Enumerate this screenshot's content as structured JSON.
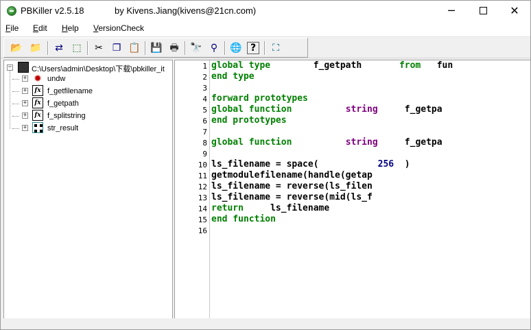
{
  "window": {
    "title": "PBKiller v2.5.18",
    "author": "by Kivens.Jiang(kivens@21cn.com)",
    "minimize": "─",
    "close": "✕"
  },
  "menu": [
    {
      "label": "File",
      "accel": "F",
      "rest": "ile"
    },
    {
      "label": "Edit",
      "accel": "E",
      "rest": "dit"
    },
    {
      "label": "Help",
      "accel": "H",
      "rest": "elp"
    },
    {
      "label": "VersionCheck",
      "accel": "V",
      "rest": "ersionCheck"
    }
  ],
  "toolbar": [
    {
      "name": "open-icon",
      "glyph": "📂"
    },
    {
      "name": "open-folder-icon",
      "glyph": "📁"
    },
    {
      "name": "decompile-icon",
      "glyph": "⇄"
    },
    {
      "name": "export-icon",
      "glyph": "⬚"
    },
    {
      "name": "cut-icon",
      "glyph": "✂"
    },
    {
      "name": "copy-icon",
      "glyph": "❐"
    },
    {
      "name": "paste-icon",
      "glyph": "📋"
    },
    {
      "name": "save-icon",
      "glyph": "💾"
    },
    {
      "name": "print-icon",
      "glyph": "🖶"
    },
    {
      "name": "find-icon",
      "glyph": "🔭"
    },
    {
      "name": "find-replace-icon",
      "glyph": "⚲"
    },
    {
      "name": "web-icon",
      "glyph": "🌐"
    },
    {
      "name": "help-icon",
      "glyph": "?"
    },
    {
      "name": "exit-icon",
      "glyph": "⛶"
    }
  ],
  "tree": {
    "root": "C:\\Users\\admin\\Desktop\\下载\\pbkiller_it",
    "items": [
      {
        "label": "undw",
        "icon": "bug-icon"
      },
      {
        "label": "f_getfilename",
        "icon": "function-icon"
      },
      {
        "label": "f_getpath",
        "icon": "function-icon"
      },
      {
        "label": "f_splitstring",
        "icon": "function-icon"
      },
      {
        "label": "str_result",
        "icon": "structure-icon"
      }
    ]
  },
  "code": {
    "lines": [
      [
        {
          "t": "global type",
          "c": "kw"
        },
        {
          "t": "        f_getpath       ",
          "c": "id"
        },
        {
          "t": "from",
          "c": "kw"
        },
        {
          "t": "   fun",
          "c": "id"
        }
      ],
      [
        {
          "t": "end type",
          "c": "kw"
        }
      ],
      [],
      [
        {
          "t": "forward prototypes",
          "c": "kw"
        }
      ],
      [
        {
          "t": "global function",
          "c": "kw"
        },
        {
          "t": "          ",
          "c": "id"
        },
        {
          "t": "string",
          "c": "ty"
        },
        {
          "t": "     f_getpa",
          "c": "id"
        }
      ],
      [
        {
          "t": "end prototypes",
          "c": "kw"
        }
      ],
      [],
      [
        {
          "t": "global function",
          "c": "kw"
        },
        {
          "t": "          ",
          "c": "id"
        },
        {
          "t": "string",
          "c": "ty"
        },
        {
          "t": "     f_getpa",
          "c": "id"
        }
      ],
      [],
      [
        {
          "t": "ls_filename = space(           ",
          "c": "id"
        },
        {
          "t": "256",
          "c": "nm"
        },
        {
          "t": "  )",
          "c": "id"
        }
      ],
      [
        {
          "t": "getmodulefilename(handle(getap",
          "c": "id"
        }
      ],
      [
        {
          "t": "ls_filename = reverse(ls_filen",
          "c": "id"
        }
      ],
      [
        {
          "t": "ls_filename = reverse(mid(ls_f",
          "c": "id"
        }
      ],
      [
        {
          "t": "return",
          "c": "kw"
        },
        {
          "t": "     ls_filename",
          "c": "id"
        }
      ],
      [
        {
          "t": "end function",
          "c": "kw"
        }
      ],
      []
    ]
  }
}
